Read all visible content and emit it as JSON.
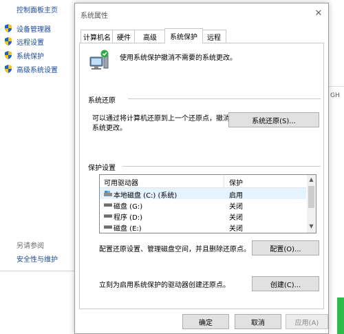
{
  "control_panel": {
    "home_link": "控制面板主页",
    "nav": [
      {
        "label": "设备管理器",
        "icon": "uac-shield-icon"
      },
      {
        "label": "远程设置",
        "icon": "uac-shield-icon"
      },
      {
        "label": "系统保护",
        "icon": "uac-shield-icon"
      },
      {
        "label": "高级系统设置",
        "icon": "uac-shield-icon"
      }
    ],
    "see_also": "另请参阅",
    "security_link": "安全性与维护",
    "right_clip_text": "GH"
  },
  "dialog": {
    "title": "系统属性",
    "tabs": [
      {
        "label": "计算机名"
      },
      {
        "label": "硬件"
      },
      {
        "label": "高级"
      },
      {
        "label": "系统保护",
        "active": true
      },
      {
        "label": "远程"
      }
    ],
    "intro": "使用系统保护撤消不需要的系统更改。",
    "restore": {
      "heading": "系统还原",
      "description": "可以通过将计算机还原到上一个还原点，撤消系统更改。",
      "button": "系统还原(S)..."
    },
    "protection": {
      "heading": "保护设置",
      "columns": [
        "可用驱动器",
        "保护"
      ],
      "drives": [
        {
          "name": "本地磁盘 (C:) (系统)",
          "protection": "启用",
          "icon": "system-drive-icon"
        },
        {
          "name": "磁盘 (G:)",
          "protection": "关闭",
          "icon": "drive-icon"
        },
        {
          "name": "程序 (D:)",
          "protection": "关闭",
          "icon": "drive-icon"
        },
        {
          "name": "磁盘 (E:)",
          "protection": "关闭",
          "icon": "drive-icon"
        }
      ],
      "config_text": "配置还原设置、管理磁盘空间，并且删除还原点。",
      "config_button": "配置(O)...",
      "create_text": "立刻为启用系统保护的驱动器创建还原点。",
      "create_button": "创建(C)..."
    },
    "footer": {
      "ok": "确定",
      "cancel": "取消",
      "apply": "应用(A)"
    }
  }
}
